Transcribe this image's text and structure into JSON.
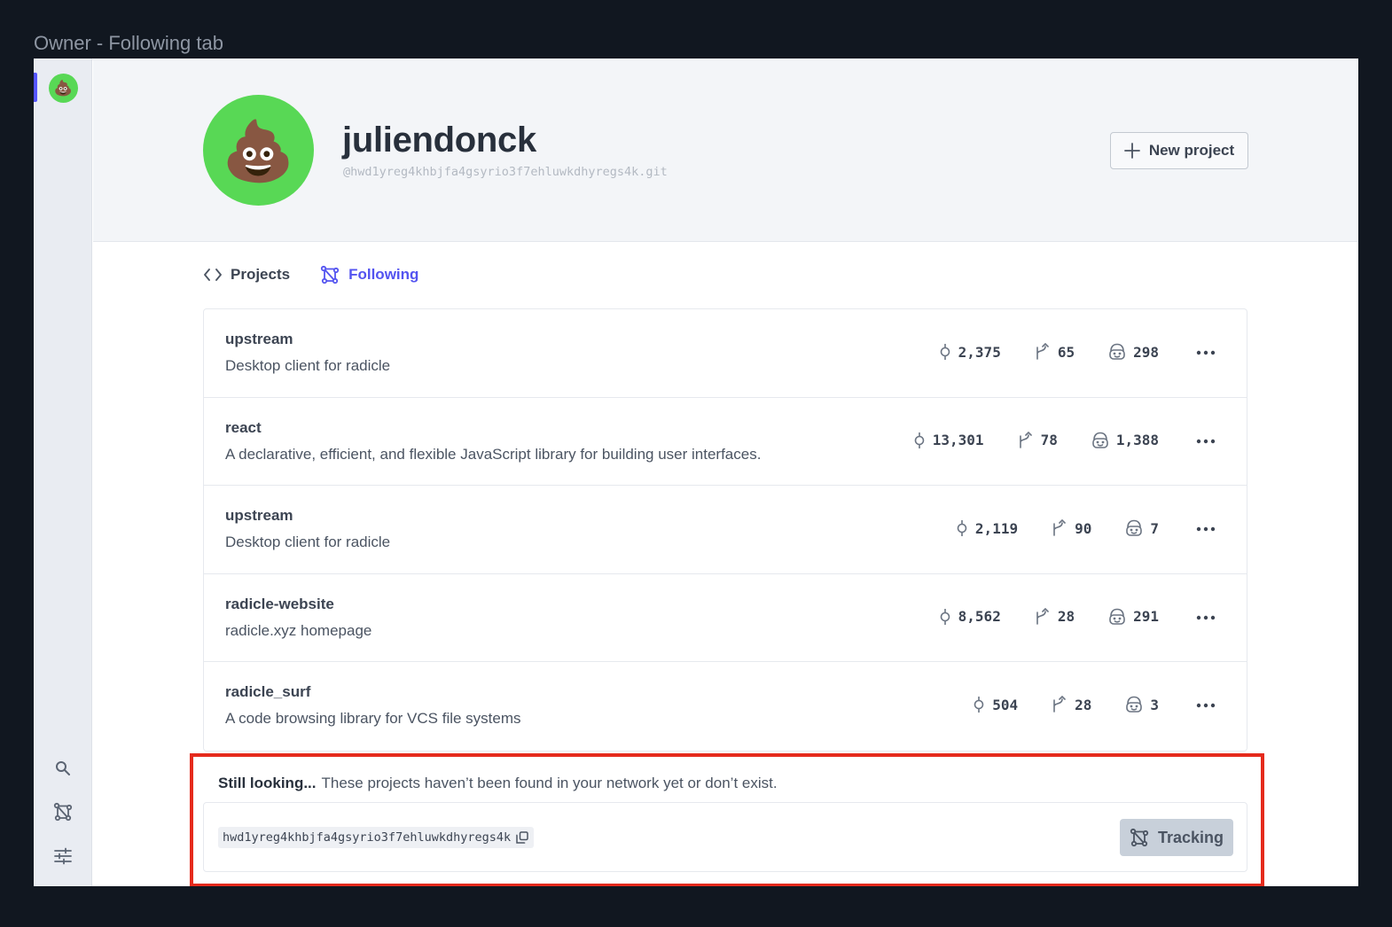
{
  "frame": {
    "title": "Owner - Following tab"
  },
  "sidebar": {
    "avatar_emoji": "💩",
    "icons": [
      "search-icon",
      "network-icon",
      "settings-icon"
    ]
  },
  "profile": {
    "avatar_emoji": "💩",
    "avatar_color": "#58d855",
    "name": "juliendonck",
    "urn": "@hwd1yreg4khbjfa4gsyrio3f7ehluwkdhyregs4k.git",
    "new_project_label": "New project"
  },
  "tabs": [
    {
      "label": "Projects",
      "icon": "code-icon",
      "active": false
    },
    {
      "label": "Following",
      "icon": "network-icon",
      "active": true
    }
  ],
  "projects": [
    {
      "name": "upstream",
      "description": "Desktop client for radicle",
      "commits": "2,375",
      "branches": "65",
      "contributors": "298"
    },
    {
      "name": "react",
      "description": "A declarative, efficient, and flexible JavaScript library for building user interfaces.",
      "commits": "13,301",
      "branches": "78",
      "contributors": "1,388"
    },
    {
      "name": "upstream",
      "description": "Desktop client for radicle",
      "commits": "2,119",
      "branches": "90",
      "contributors": "7"
    },
    {
      "name": "radicle-website",
      "description": "radicle.xyz homepage",
      "commits": "8,562",
      "branches": "28",
      "contributors": "291"
    },
    {
      "name": "radicle_surf",
      "description": "A code browsing library for VCS file systems",
      "commits": "504",
      "branches": "28",
      "contributors": "3"
    }
  ],
  "still_looking": {
    "title": "Still looking...",
    "message": "These projects haven’t been found in your network yet or don’t exist.",
    "items": [
      {
        "urn": "hwd1yreg4khbjfa4gsyrio3f7ehluwkdhyregs4k",
        "button_label": "Tracking"
      }
    ]
  },
  "colors": {
    "accent": "#5454f0",
    "highlight": "#e52a1c",
    "background": "#111720"
  }
}
